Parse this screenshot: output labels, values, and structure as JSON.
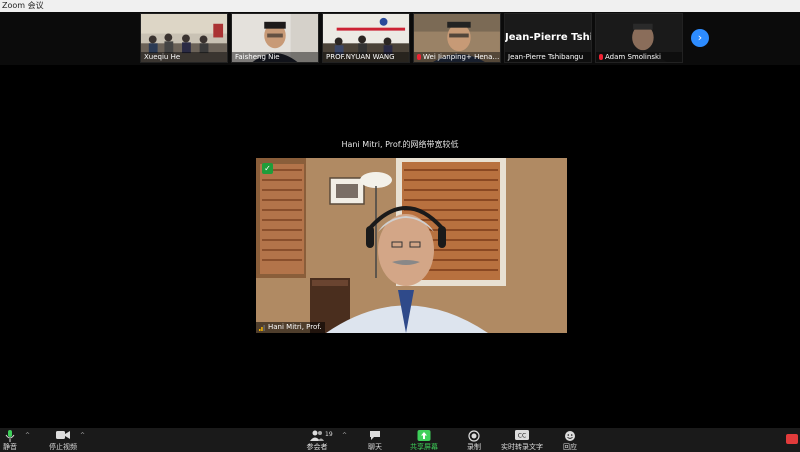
{
  "window": {
    "title": "Zoom 会议"
  },
  "gallery": {
    "participants": [
      {
        "name": "Xueqiu He",
        "muted": false
      },
      {
        "name": "Faisheng Nie",
        "muted": false
      },
      {
        "name": "PROF.NYUAN WANG",
        "muted": false
      },
      {
        "name": "Wei Jianping+ Henan ...",
        "muted": true
      },
      {
        "name": "Jean-Pierre Tshibangu",
        "muted": false,
        "avatar_text": "Jean-Pierre  Tshi..."
      },
      {
        "name": "Adam Smolinski",
        "muted": true
      }
    ],
    "next_icon": "chevron-right-icon"
  },
  "stage": {
    "notice": "Hani Mitri, Prof.的网络带宽较低",
    "speaker_name": "Hani Mitri, Prof."
  },
  "toolbar": {
    "mute_label": "静音",
    "video_label": "停止视频",
    "participants_label": "参会者",
    "participants_count": "19",
    "chat_label": "聊天",
    "share_label": "共享屏幕",
    "record_label": "录制",
    "captions_label": "实时转录文字",
    "reactions_label": "回应"
  },
  "colors": {
    "accent": "#2d8cff",
    "share": "#3ecf5a",
    "mute": "#e23b3b"
  }
}
